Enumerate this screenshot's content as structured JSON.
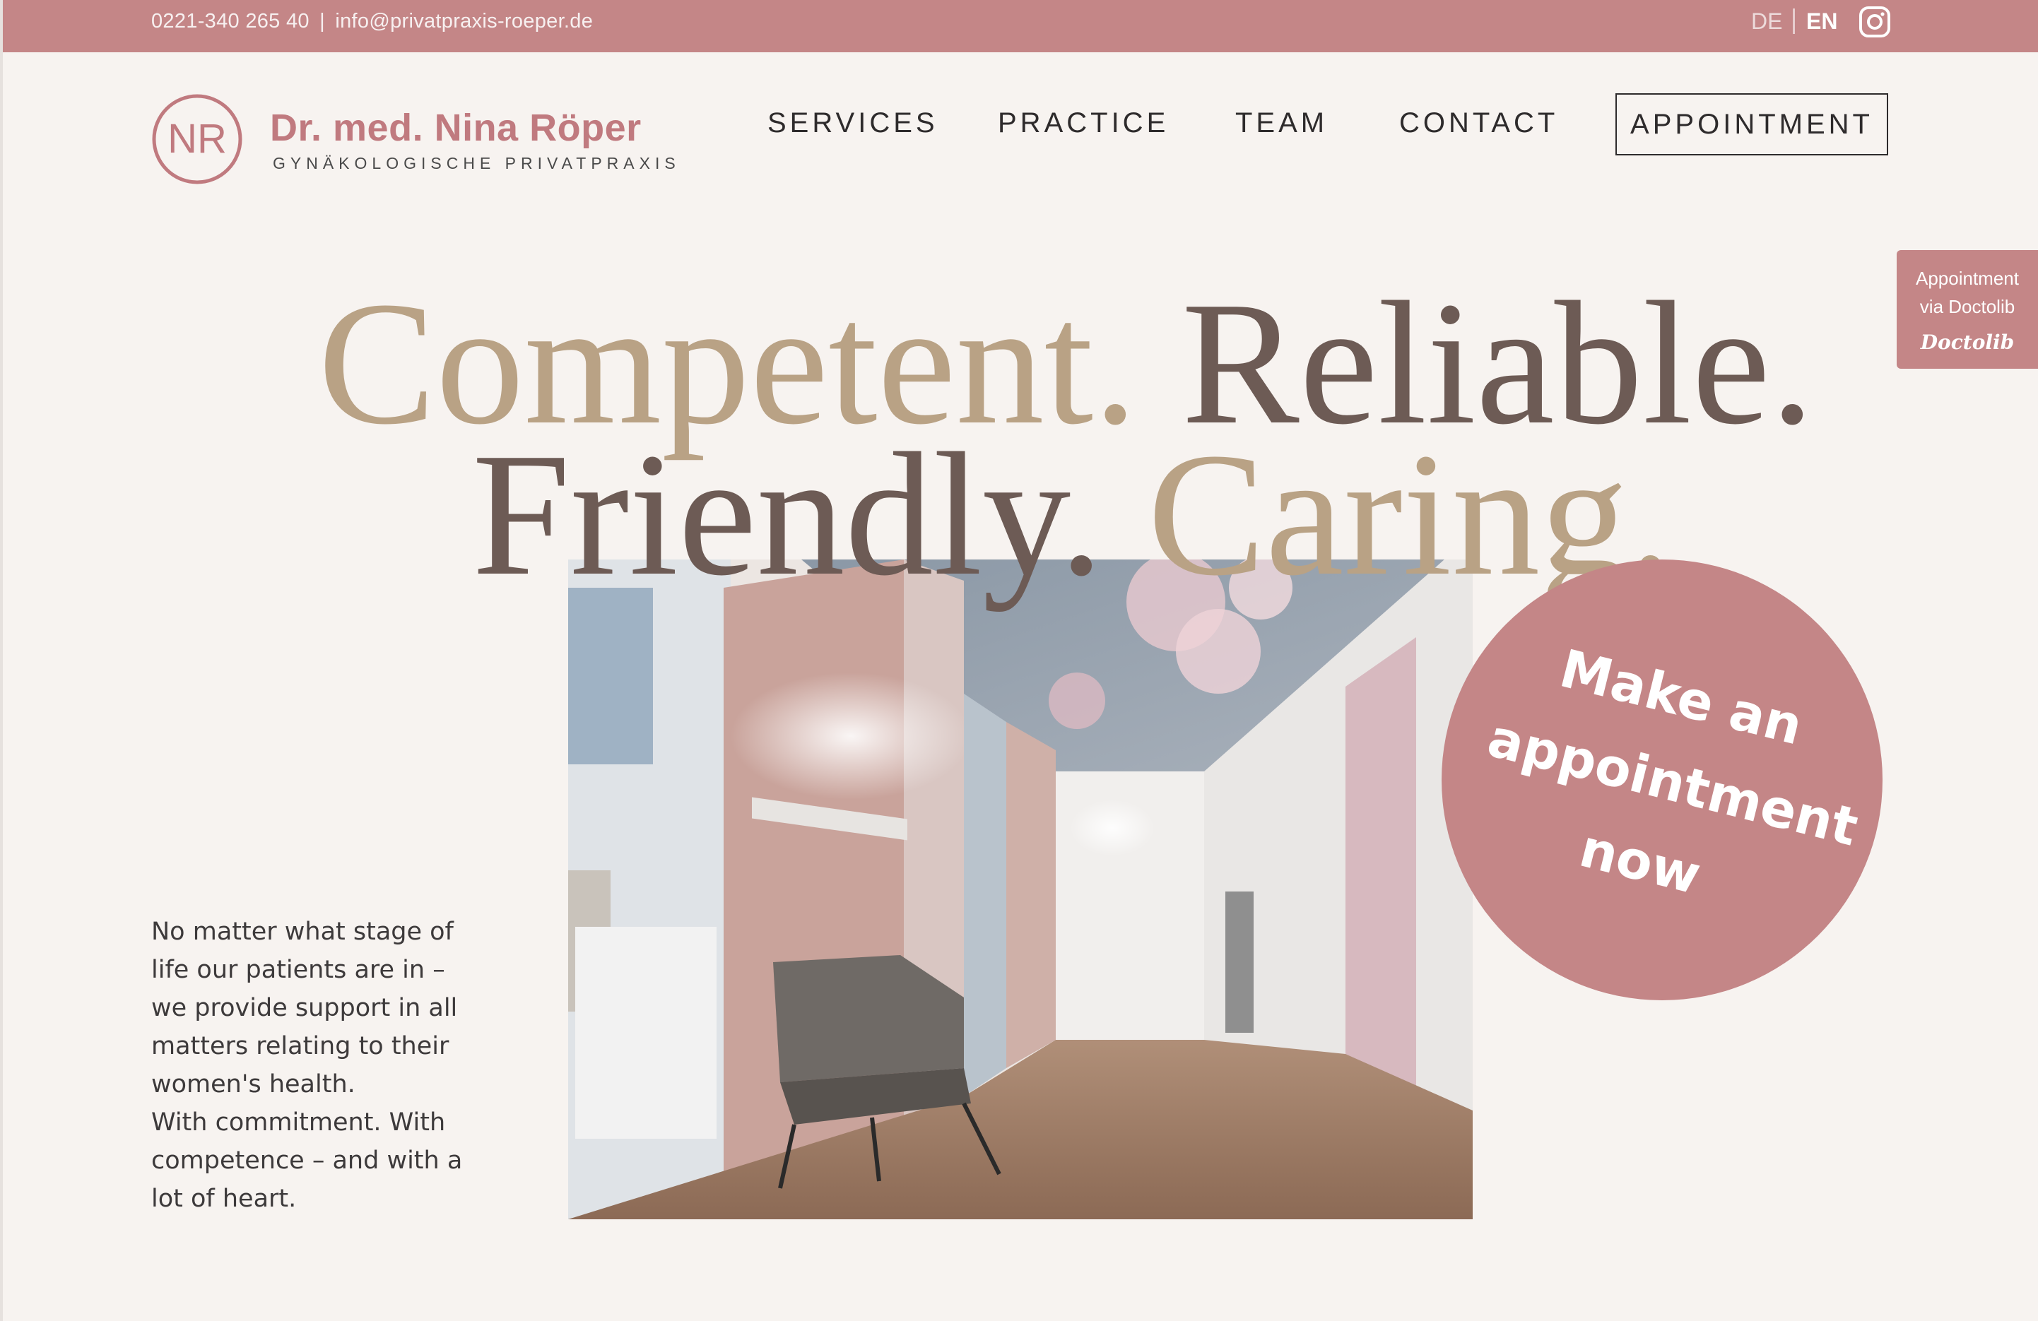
{
  "topbar": {
    "phone": "0221-340 265 40",
    "separator": "|",
    "email": "info@privatpraxis-roeper.de",
    "lang_de": "DE",
    "lang_en": "EN",
    "social_icon": "instagram-icon"
  },
  "brand": {
    "name": "Dr. med. Nina Röper",
    "subtitle": "GYNÄKOLOGISCHE PRIVATPRAXIS",
    "logo_initials": "NR"
  },
  "nav": {
    "items": [
      "SERVICES",
      "PRACTICE",
      "TEAM",
      "CONTACT"
    ],
    "appointment": "APPOINTMENT"
  },
  "side_tab": {
    "line1": "Appointment",
    "line2": "via Doctolib",
    "brand": "Doctolib"
  },
  "hero": {
    "word1": "Competent.",
    "word2": "Reliable.",
    "word3": "Friendly.",
    "word4": "Caring.",
    "cta_line1": "Make an",
    "cta_line2": "appointment",
    "cta_line3": "now"
  },
  "intro": {
    "line1": "No matter what stage of",
    "line2": "life our patients are in –",
    "line3": "we provide support in all",
    "line4": "matters relating to their",
    "line5": "women's health.",
    "line6": "With commitment. With",
    "line7": "competence – and with a",
    "line8": "lot of heart."
  },
  "colors": {
    "accent": "#c48687",
    "gold": "#b9a285",
    "brown": "#6d5b55",
    "background": "#f7f3f0"
  }
}
